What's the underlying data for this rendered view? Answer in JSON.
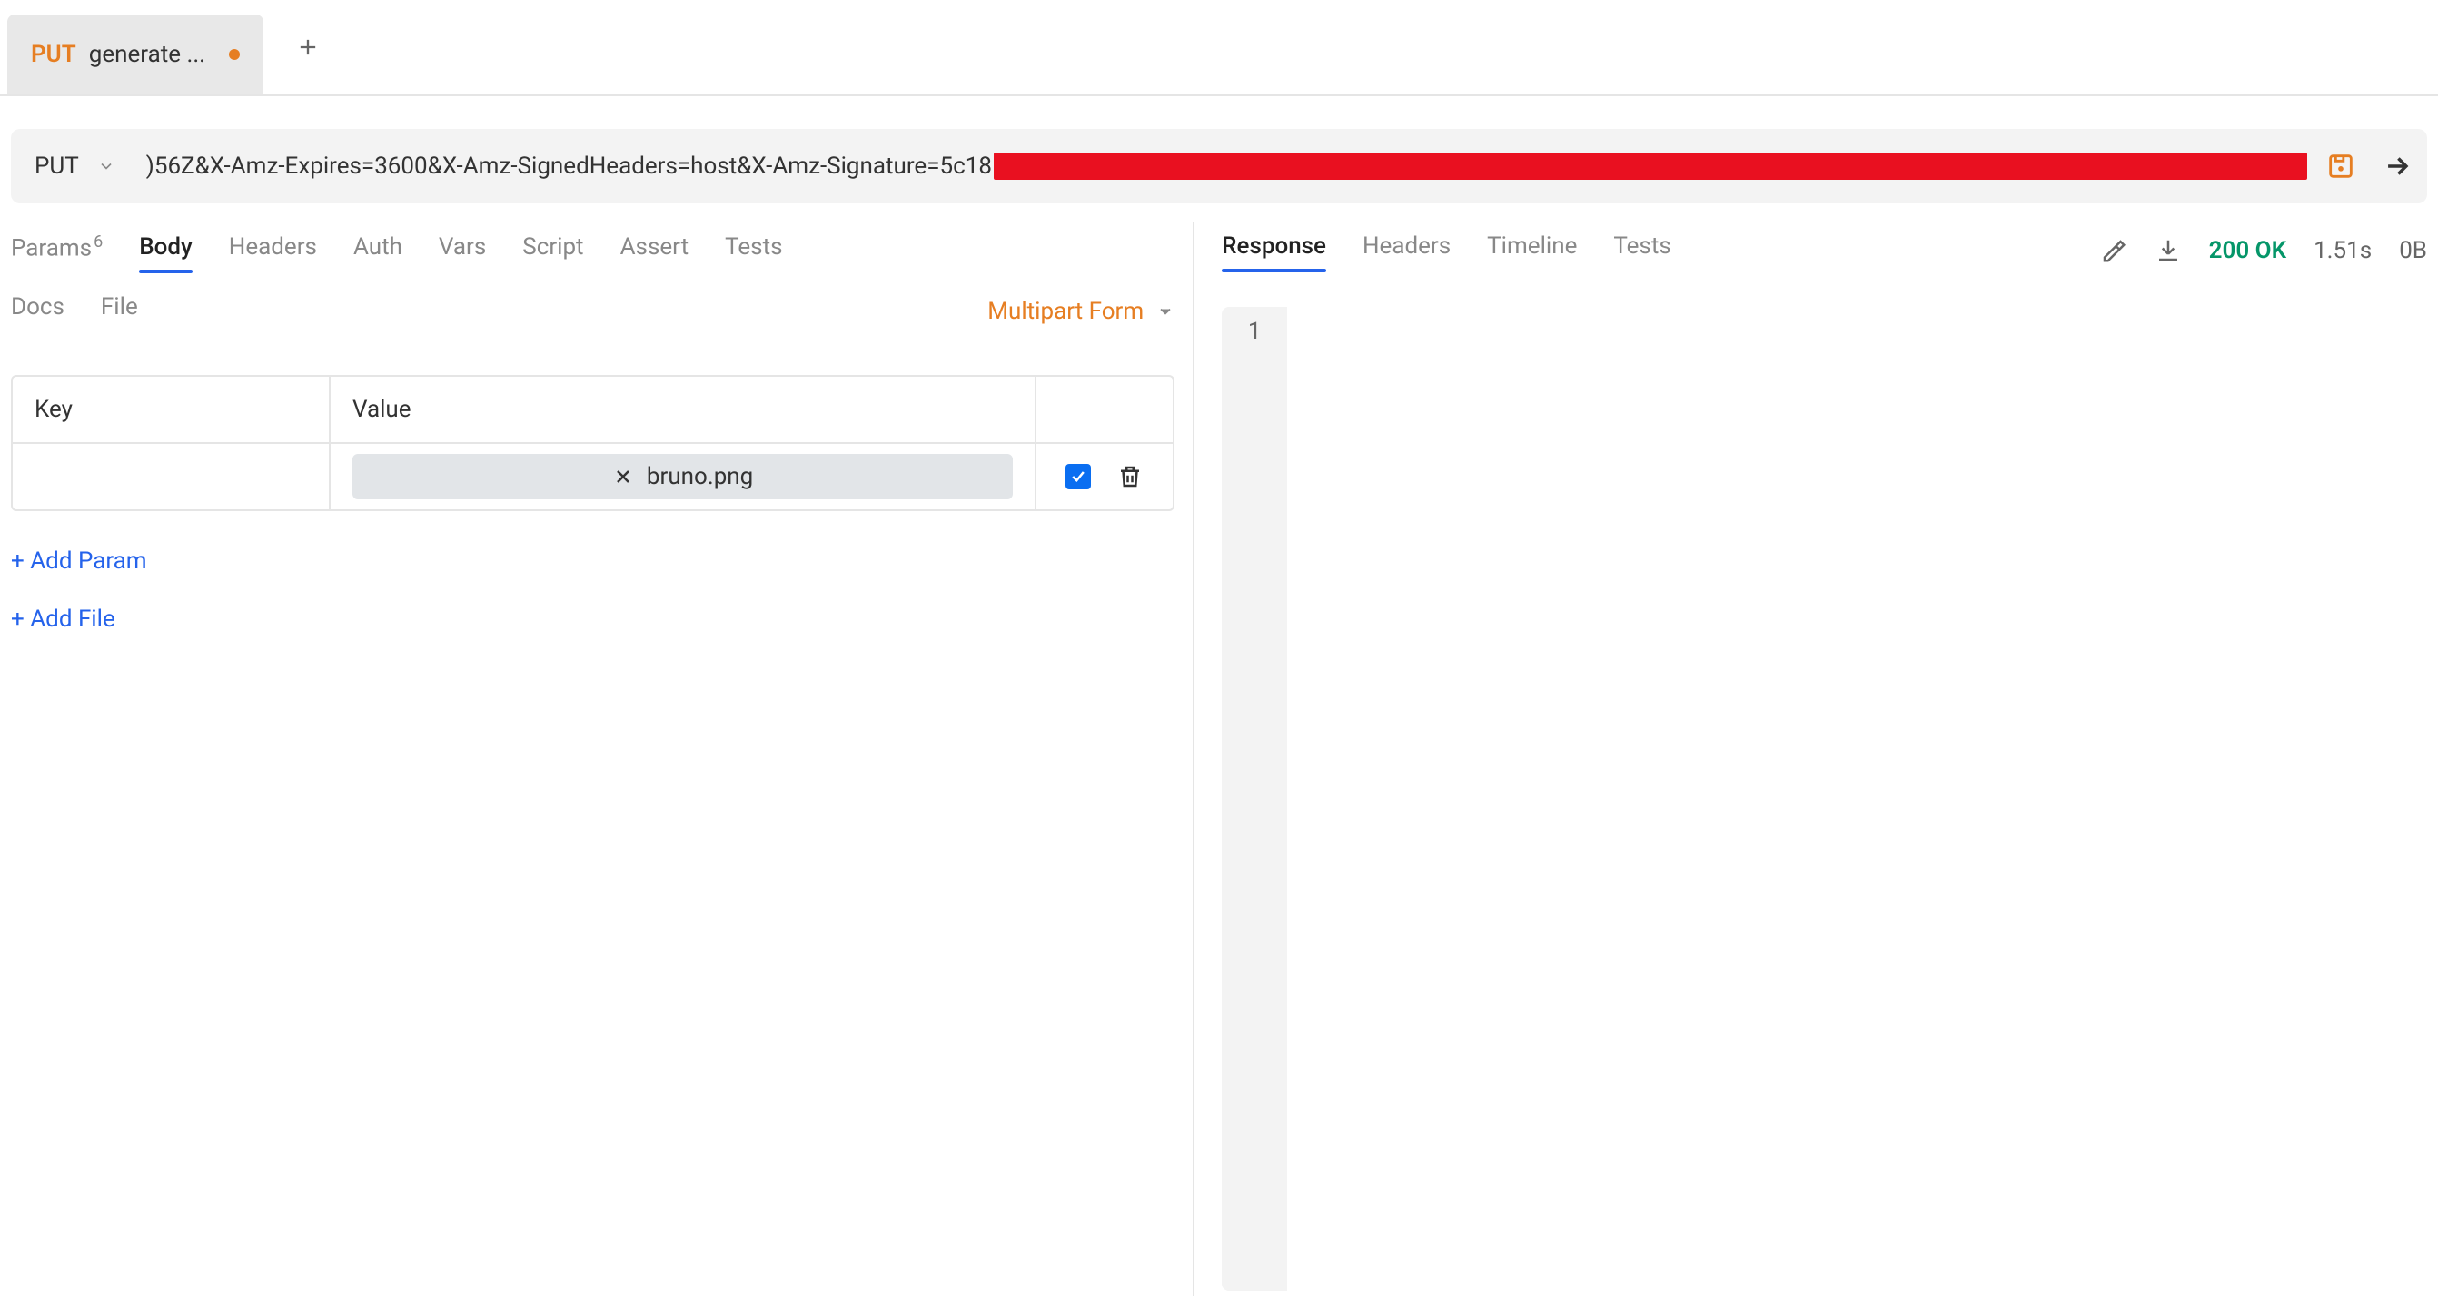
{
  "tab": {
    "method": "PUT",
    "title": "generate ...",
    "modified": true
  },
  "urlBar": {
    "method": "PUT",
    "urlVisible": ")56Z&X-Amz-Expires=3600&X-Amz-SignedHeaders=host&X-Amz-Signature=5c18"
  },
  "requestTabs": {
    "params": {
      "label": "Params",
      "count": "6"
    },
    "body": "Body",
    "headers": "Headers",
    "auth": "Auth",
    "vars": "Vars",
    "script": "Script",
    "assert": "Assert",
    "tests": "Tests",
    "docs": "Docs",
    "file": "File"
  },
  "bodyType": "Multipart Form",
  "kvTable": {
    "headerKey": "Key",
    "headerValue": "Value",
    "rows": [
      {
        "key": "",
        "fileName": "bruno.png",
        "enabled": true
      }
    ]
  },
  "addParamLabel": "+ Add Param",
  "addFileLabel": "+ Add File",
  "responseTabs": {
    "response": "Response",
    "headers": "Headers",
    "timeline": "Timeline",
    "tests": "Tests"
  },
  "responseMeta": {
    "status": "200 OK",
    "time": "1.51s",
    "size": "0B"
  },
  "responseLines": [
    "1"
  ]
}
